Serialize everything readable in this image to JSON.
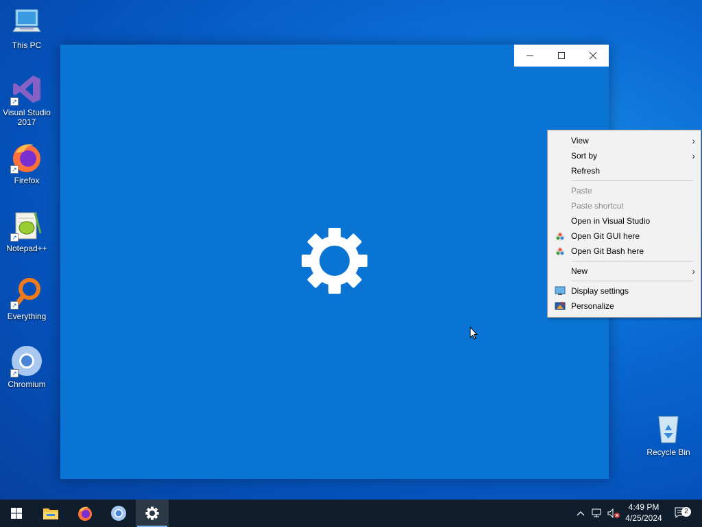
{
  "desktop": {
    "icons": [
      {
        "label": "This PC",
        "icon": "this-pc-icon"
      },
      {
        "label": "Visual Studio 2017",
        "icon": "visual-studio-icon"
      },
      {
        "label": "Firefox",
        "icon": "firefox-icon"
      },
      {
        "label": "Notepad++",
        "icon": "notepadpp-icon"
      },
      {
        "label": "Everything",
        "icon": "everything-icon"
      },
      {
        "label": "Chromium",
        "icon": "chromium-icon"
      },
      {
        "label": "Recycle Bin",
        "icon": "recycle-bin-icon"
      }
    ]
  },
  "window": {
    "controls": [
      "minimize",
      "maximize",
      "close"
    ],
    "splash_icon": "gear-icon",
    "background": "#0a74d4"
  },
  "context_menu": {
    "items": [
      {
        "label": "View",
        "submenu": true
      },
      {
        "label": "Sort by",
        "submenu": true
      },
      {
        "label": "Refresh"
      },
      {
        "label": "Paste",
        "disabled": true
      },
      {
        "label": "Paste shortcut",
        "disabled": true
      },
      {
        "label": "Open in Visual Studio"
      },
      {
        "label": "Open Git GUI here",
        "icon": "git-icon"
      },
      {
        "label": "Open Git Bash here",
        "icon": "git-icon"
      },
      {
        "label": "New",
        "submenu": true
      },
      {
        "label": "Display settings",
        "icon": "display-icon"
      },
      {
        "label": "Personalize",
        "icon": "personalize-icon"
      }
    ]
  },
  "taskbar": {
    "pinned": [
      "start-icon",
      "file-explorer-icon",
      "firefox-icon",
      "chromium-icon",
      "settings-icon"
    ],
    "clock": {
      "time": "4:49 PM",
      "date": "4/25/2024"
    },
    "notification_count": "2"
  }
}
